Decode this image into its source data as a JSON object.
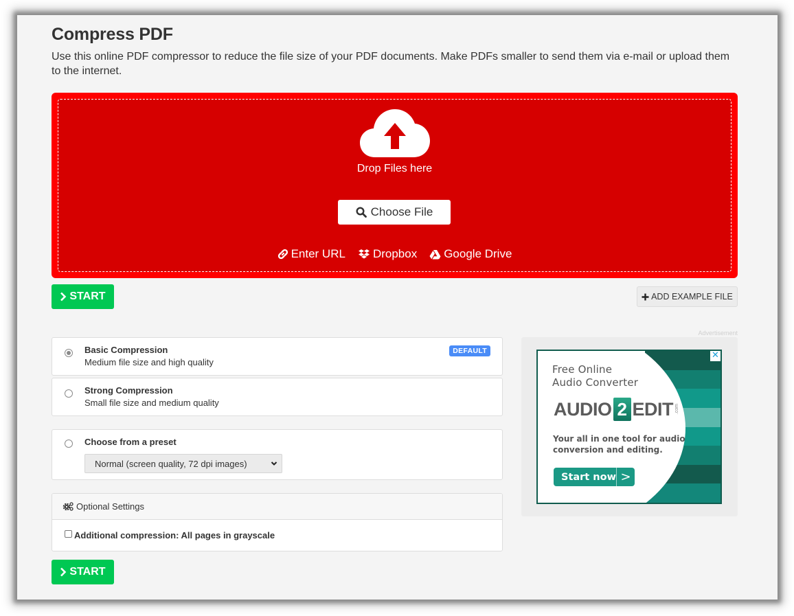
{
  "page": {
    "title": "Compress PDF",
    "description": "Use this online PDF compressor to reduce the file size of your PDF documents. Make PDFs smaller to send them via e-mail or upload them to the internet."
  },
  "dropzone": {
    "icon": "cloud-upload-icon",
    "label": "Drop Files here",
    "choose_file_label": "Choose File",
    "choose_file_icon": "search-icon",
    "sources": [
      {
        "label": "Enter URL",
        "icon": "link-icon"
      },
      {
        "label": "Dropbox",
        "icon": "dropbox-icon"
      },
      {
        "label": "Google Drive",
        "icon": "google-drive-icon"
      }
    ],
    "colors": {
      "outer": "#ff0000",
      "inner": "#d60000"
    }
  },
  "actions": {
    "start_label": "START",
    "start_icon": "chevron-right-icon",
    "add_example_label": "ADD EXAMPLE FILE",
    "add_example_icon": "plus-icon",
    "start_color": "#00c853"
  },
  "options": {
    "compression": [
      {
        "title": "Basic Compression",
        "subtitle": "Medium file size and high quality",
        "selected": true,
        "badge": "DEFAULT"
      },
      {
        "title": "Strong Compression",
        "subtitle": "Small file size and medium quality",
        "selected": false
      }
    ],
    "preset": {
      "title": "Choose from a preset",
      "selected": false,
      "select_value": "Normal (screen quality, 72 dpi images)"
    }
  },
  "optional_settings": {
    "header": "Optional Settings",
    "icon": "gears-icon",
    "checkbox_label": "Additional compression: All pages in grayscale",
    "checked": false
  },
  "advertisement": {
    "label": "Advertisement",
    "headline_line1": "Free Online",
    "headline_line2": "Audio Converter",
    "logo_left": "AUDIO",
    "logo_mid": "2",
    "logo_right": "EDIT",
    "logo_suffix": ".com",
    "body_line1": "Your all in one tool for audio",
    "body_line2": "conversion and editing.",
    "cta_label": "Start now",
    "cta_arrow": ">",
    "close_glyph": "✕",
    "stripe_colors": [
      "#135a4d",
      "#127f70",
      "#11998a",
      "#5bb8ac",
      "#11998a",
      "#127f70",
      "#135a4d",
      "#13877a"
    ]
  }
}
